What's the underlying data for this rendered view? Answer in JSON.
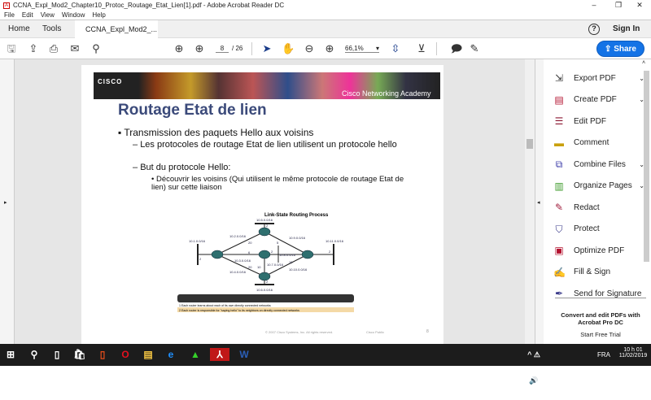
{
  "window": {
    "title": "CCNA_Expl_Mod2_Chapter10_Protoc_Routage_Etat_Lien[1].pdf - Adobe Acrobat Reader DC",
    "minimize": "–",
    "restore": "❐",
    "close": "✕"
  },
  "menu": [
    "File",
    "Edit",
    "View",
    "Window",
    "Help"
  ],
  "tabs": {
    "home": "Home",
    "tools": "Tools",
    "doc": "CCNA_Expl_Mod2_...",
    "close": "×",
    "help": "?",
    "signin": "Sign In"
  },
  "toolbar": {
    "page_current": "8",
    "page_total": "/ 26",
    "zoom": "66,1%",
    "share": "Share"
  },
  "slide": {
    "logo": "CISCO",
    "academy": "Cisco Networking Academy",
    "title": "Routage Etat de lien",
    "bullet1": "Transmission des paquets Hello aux voisins",
    "sub1": "Les protocoles de routage Etat de lien utilisent un protocole hello",
    "sub2": "But du protocole Hello:",
    "subsub1": "Découvrir les voisins (Qui utilisent le même protocole de routage Etat de lien) sur cette liaison",
    "diagram_title": "Link-State Routing Process",
    "networks": [
      "10.5.0.0/16",
      "10.2.0.0/16",
      "10.9.0.0/16",
      "10.1.0.0/16",
      "10.11.0.0/16",
      "10.3.0.0/16",
      "10.7.0.0/16",
      "10.4.0.0/16",
      "10.10.0.0/16",
      "10.6.0.0/16",
      "10.8.0.0/16"
    ],
    "costs": [
      "2",
      "20",
      "5",
      "2",
      "6",
      "2",
      "2",
      "20",
      "10",
      "10",
      "2"
    ],
    "step1": "1   Each router learns about each of its own directly connected networks",
    "step2": "2   Each router is responsible for \"saying hello\" to its neighbors on directly connected networks",
    "footer_copy": "© 2007 Cisco Systems, Inc. All rights reserved.",
    "footer_public": "Cisco Public",
    "footer_page": "8"
  },
  "tools_pane": {
    "items": [
      {
        "label": "Export PDF",
        "icon": "export-pdf-icon",
        "glyph": "⇲",
        "color": "#333",
        "chevron": true
      },
      {
        "label": "Create PDF",
        "icon": "create-pdf-icon",
        "glyph": "▤",
        "color": "#b3112e",
        "chevron": true
      },
      {
        "label": "Edit PDF",
        "icon": "edit-pdf-icon",
        "glyph": "☰",
        "color": "#8a1530",
        "chevron": false
      },
      {
        "label": "Comment",
        "icon": "comment-icon",
        "glyph": "▬",
        "color": "#c9a00c",
        "chevron": false
      },
      {
        "label": "Combine Files",
        "icon": "combine-files-icon",
        "glyph": "⧉",
        "color": "#3a3aa8",
        "chevron": true
      },
      {
        "label": "Organize Pages",
        "icon": "organize-pages-icon",
        "glyph": "▥",
        "color": "#3c9a2a",
        "chevron": true
      },
      {
        "label": "Redact",
        "icon": "redact-icon",
        "glyph": "✎",
        "color": "#a01c3c",
        "chevron": false
      },
      {
        "label": "Protect",
        "icon": "protect-icon",
        "glyph": "⛉",
        "color": "#3a3a8a",
        "chevron": false
      },
      {
        "label": "Optimize PDF",
        "icon": "optimize-pdf-icon",
        "glyph": "▣",
        "color": "#b3112e",
        "chevron": false
      },
      {
        "label": "Fill & Sign",
        "icon": "fill-sign-icon",
        "glyph": "✍",
        "color": "#4a3aa0",
        "chevron": false
      },
      {
        "label": "Send for Signature",
        "icon": "send-signature-icon",
        "glyph": "✒",
        "color": "#3a3a8a",
        "chevron": false
      }
    ],
    "promo": "Convert and edit PDFs with Acrobat Pro DC",
    "trial": "Start Free Trial"
  },
  "taskbar": {
    "lang": "FRA",
    "time": "10 h 01",
    "date": "11/02/2019"
  }
}
